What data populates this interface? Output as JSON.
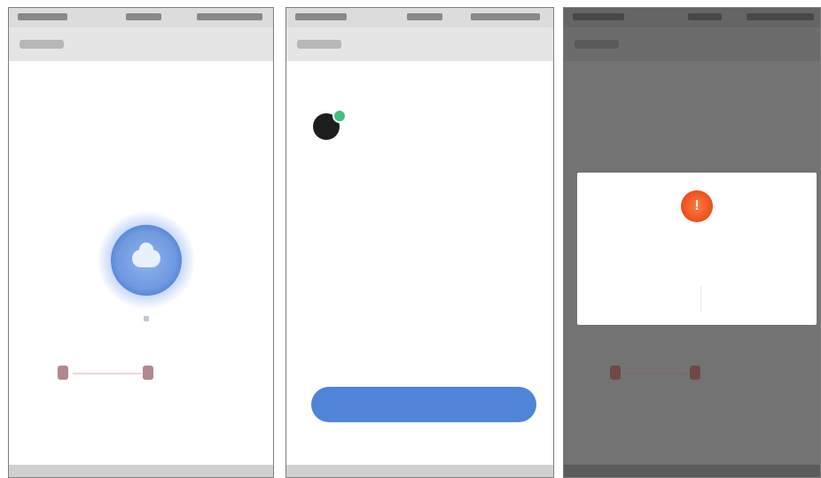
{
  "screens": [
    {
      "status_time": "",
      "nav_title": "",
      "title": "",
      "subtitle": "",
      "device_labels": [
        "",
        ""
      ]
    },
    {
      "status_time": "",
      "nav_title": "",
      "heading": "",
      "device": {
        "name": "",
        "meta": "",
        "status_color": "#41c07e"
      },
      "primary_button": ""
    },
    {
      "status_time": "",
      "nav_title": "",
      "title": "",
      "subtitle": "",
      "dialog": {
        "icon": "!",
        "icon_name": "warning-icon",
        "message": "",
        "left_button": "",
        "right_button": ""
      },
      "device_labels": [
        "",
        ""
      ]
    }
  ],
  "colors": {
    "accent_blue": "#4f84d9",
    "warning_orange": "#ea4f1c",
    "online_green": "#41c07e",
    "overlay_gray": "#737373"
  }
}
